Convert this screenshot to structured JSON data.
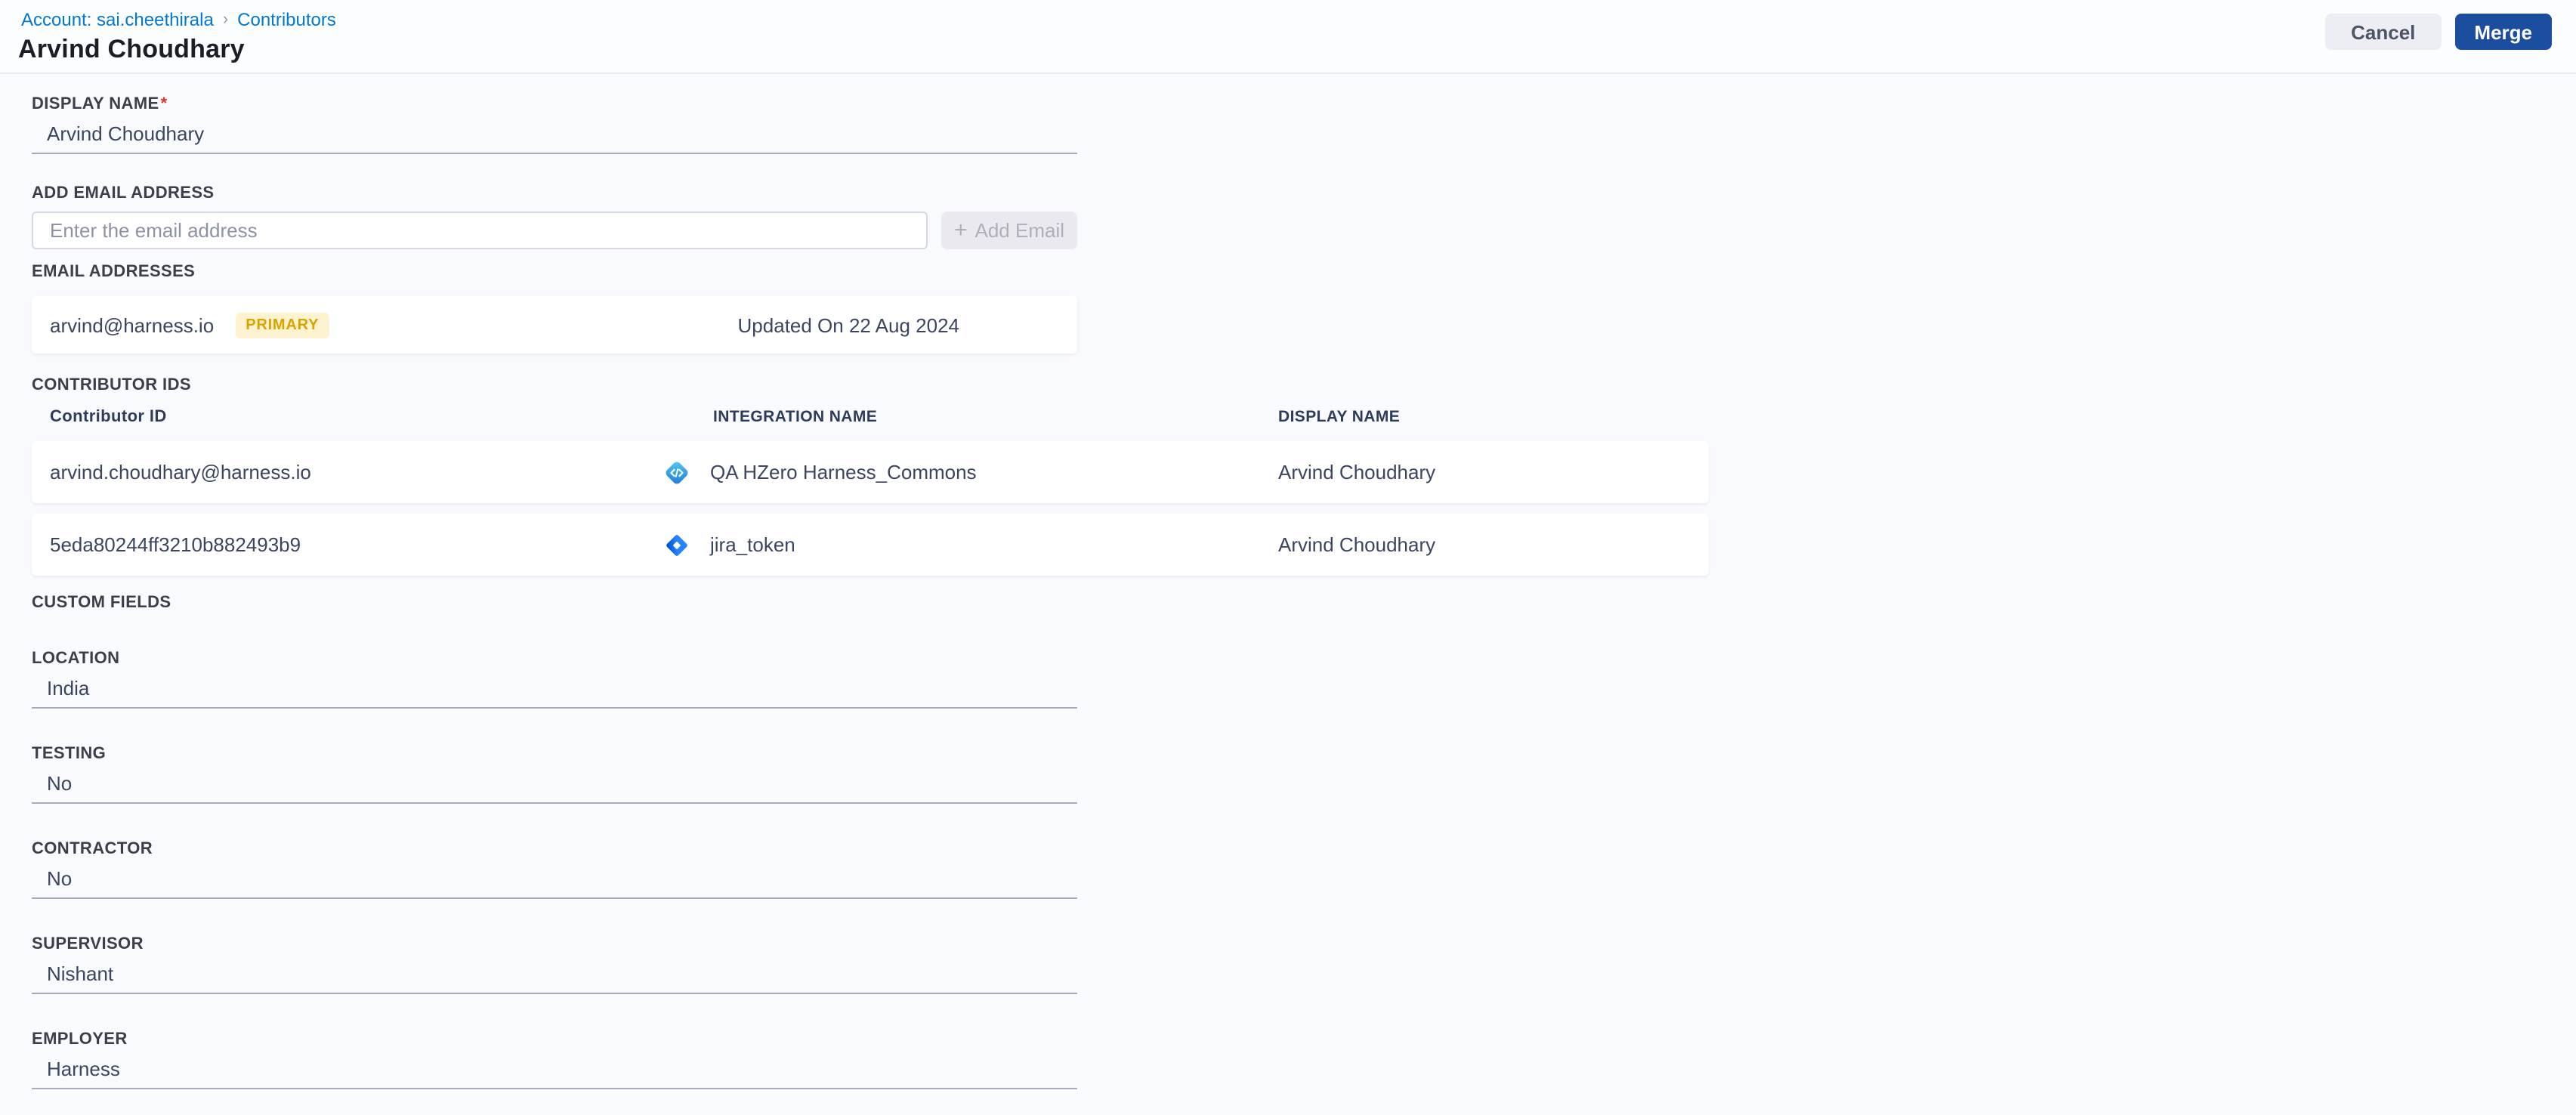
{
  "breadcrumb": {
    "account_label": "Account: sai.cheethirala",
    "separator": "›",
    "current_label": "Contributors"
  },
  "header": {
    "title": "Arvind Choudhary",
    "cancel_label": "Cancel",
    "merge_label": "Merge"
  },
  "display_name": {
    "label": "DISPLAY NAME",
    "required_mark": "*",
    "value": "Arvind Choudhary"
  },
  "add_email": {
    "label": "ADD EMAIL ADDRESS",
    "placeholder": "Enter the email address",
    "plus": "+",
    "button_label": "Add Email"
  },
  "email_addresses": {
    "label": "EMAIL ADDRESSES",
    "items": [
      {
        "email": "arvind@harness.io",
        "badge": "PRIMARY",
        "updated": "Updated On 22 Aug 2024"
      }
    ]
  },
  "contributor_ids": {
    "label": "CONTRIBUTOR IDS",
    "columns": {
      "id": "Contributor ID",
      "integration": "INTEGRATION NAME",
      "display": "DISPLAY NAME"
    },
    "rows": [
      {
        "id": "arvind.choudhary@harness.io",
        "icon": "code-icon",
        "integration": "QA HZero Harness_Commons",
        "display": "Arvind Choudhary"
      },
      {
        "id": "5eda80244ff3210b882493b9",
        "icon": "jira-icon",
        "integration": "jira_token",
        "display": "Arvind Choudhary"
      }
    ]
  },
  "custom_fields": {
    "label": "CUSTOM FIELDS",
    "fields": [
      {
        "label": "LOCATION",
        "value": "India"
      },
      {
        "label": "TESTING",
        "value": "No"
      },
      {
        "label": "CONTRACTOR",
        "value": "No"
      },
      {
        "label": "SUPERVISOR",
        "value": "Nishant"
      },
      {
        "label": "EMPLOYER",
        "value": "Harness"
      }
    ]
  },
  "colors": {
    "link_blue": "#0278d5",
    "merge_button_bg": "#1b4e9e",
    "primary_badge_bg": "#fdf3d1",
    "primary_badge_text": "#d9a400",
    "required_red": "#e43326",
    "page_bg": "#f9fafd"
  }
}
